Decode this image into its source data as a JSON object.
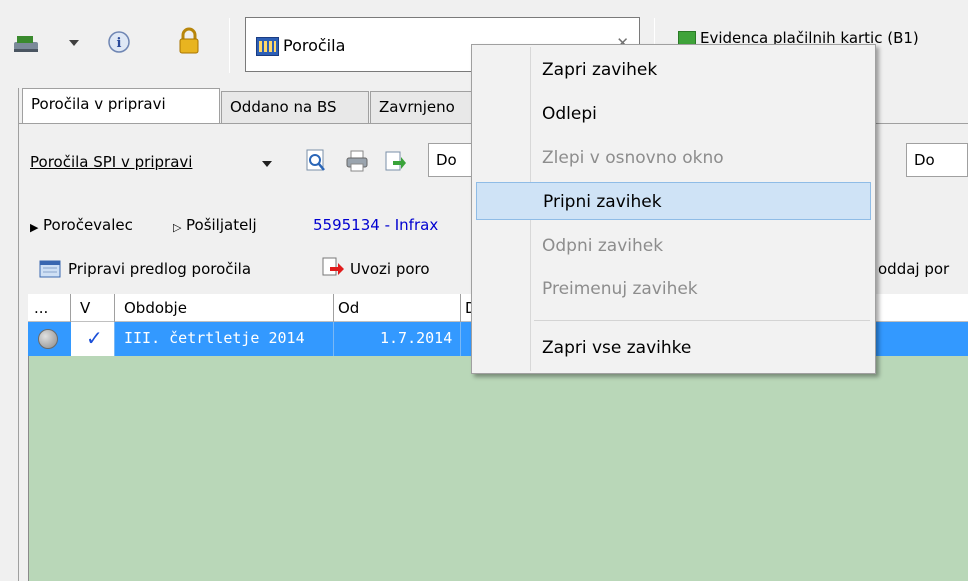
{
  "toolbar": {
    "combo_value": "Poročila",
    "right_tab_label": "Evidenca plačilnih kartic (B1)"
  },
  "tabs": [
    {
      "label": "Poročila v pripravi"
    },
    {
      "label": "Oddano na BS"
    },
    {
      "label": "Zavrnjeno"
    }
  ],
  "filter": {
    "dropdown_label": "Poročila SPI v pripravi",
    "do_label_1": "Do",
    "do_label_2": "Do"
  },
  "info": {
    "porocevalec": "Poročevalec",
    "posiljatelj": "Pošiljatelj",
    "id_text": "5595134 - Infrax"
  },
  "actions": {
    "pripravi": "Pripravi predlog poročila",
    "uvozi": "Uvozi poro",
    "oddaj": "oddaj por"
  },
  "grid": {
    "columns": [
      "...",
      "V",
      "Obdobje",
      "Od",
      "D"
    ],
    "rows": [
      {
        "check": "✓",
        "obdobje": "III. četrtletje 2014",
        "od": "1.7.2014"
      }
    ]
  },
  "context_menu": {
    "items": [
      {
        "label": "Zapri zavihek",
        "enabled": true
      },
      {
        "label": "Odlepi",
        "enabled": true
      },
      {
        "label": "Zlepi v osnovno okno",
        "enabled": false
      },
      {
        "label": "Pripni zavihek",
        "enabled": true,
        "highlighted": true
      },
      {
        "label": "Odpni zavihek",
        "enabled": false
      },
      {
        "label": "Preimenuj zavihek",
        "enabled": false
      },
      {
        "label": "Zapri vse zavihke",
        "enabled": true
      }
    ]
  },
  "colors": {
    "grid_bg": "#b9d7b8",
    "row_selected": "#3399ff",
    "menu_highlight": "#cfe3f6"
  }
}
